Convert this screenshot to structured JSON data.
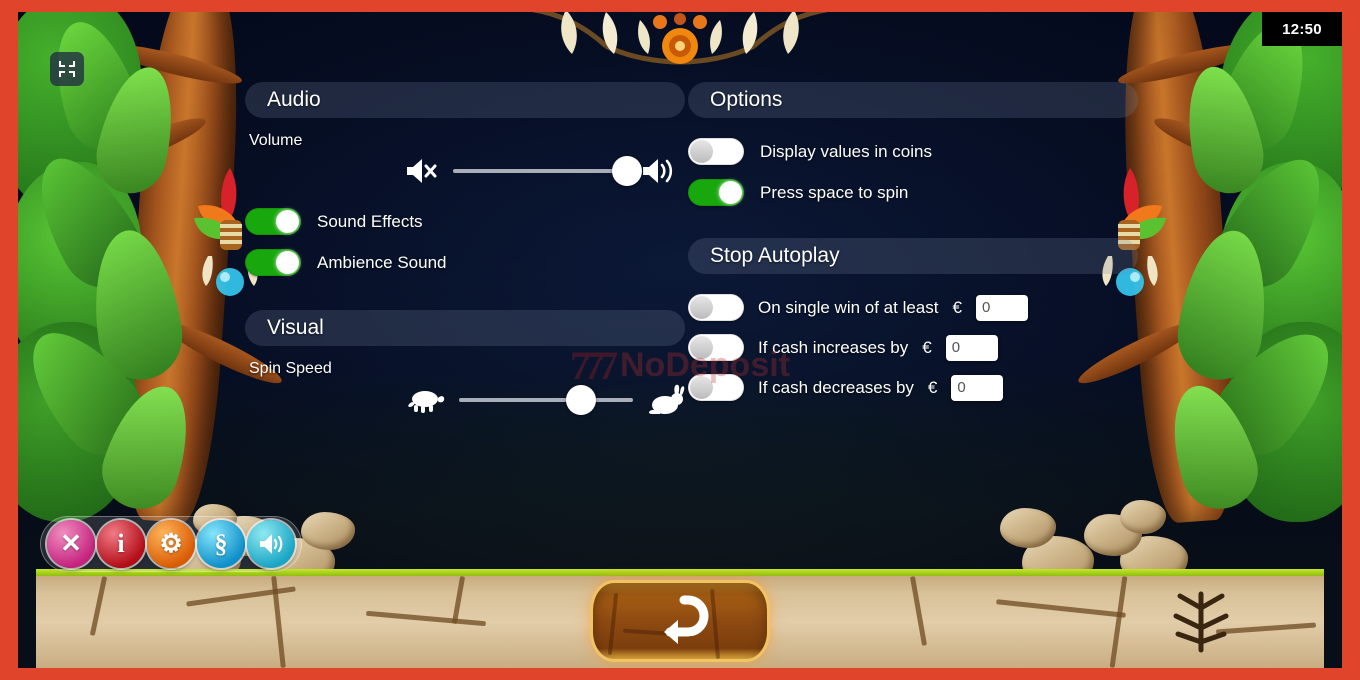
{
  "window": {
    "clock": "12:50",
    "border_color": "#e0452c",
    "accent_green": "#18a80d"
  },
  "top_bar": {
    "fullscreen_icon": "compress-icon"
  },
  "settings": {
    "audio": {
      "title": "Audio",
      "volume_label": "Volume",
      "volume_value": 100,
      "mute_icon": "speaker-mute-icon",
      "loud_icon": "speaker-loud-icon",
      "toggles": [
        {
          "label": "Sound Effects",
          "state": "on"
        },
        {
          "label": "Ambience Sound",
          "state": "on"
        }
      ]
    },
    "visual": {
      "title": "Visual",
      "spin_speed_label": "Spin Speed",
      "spin_speed_value": 70,
      "slow_icon": "turtle-icon",
      "fast_icon": "rabbit-icon"
    },
    "options": {
      "title": "Options",
      "toggles": [
        {
          "label": "Display values in coins",
          "state": "off"
        },
        {
          "label": "Press space to spin",
          "state": "on"
        }
      ]
    },
    "stop_autoplay": {
      "title": "Stop Autoplay",
      "currency": "€",
      "rows": [
        {
          "label": "On single win of at least",
          "state": "off",
          "value": "0"
        },
        {
          "label": "If cash increases by",
          "state": "off",
          "value": "0"
        },
        {
          "label": "If cash decreases by",
          "state": "off",
          "value": "0"
        }
      ]
    }
  },
  "toolbar": {
    "buttons": [
      {
        "name": "close-button",
        "glyph": "✕",
        "icon": "close-icon"
      },
      {
        "name": "info-button",
        "glyph": "i",
        "icon": "info-icon"
      },
      {
        "name": "gear-button",
        "glyph": "⚙",
        "icon": "gear-icon"
      },
      {
        "name": "rules-button",
        "glyph": "§",
        "icon": "paragraph-icon"
      },
      {
        "name": "sound-button",
        "glyph": "🔊",
        "icon": "speaker-icon"
      }
    ]
  },
  "back_button": {
    "icon": "back-arrow-icon"
  },
  "watermark": {
    "sevens": "777",
    "text": "NoDeposit"
  }
}
